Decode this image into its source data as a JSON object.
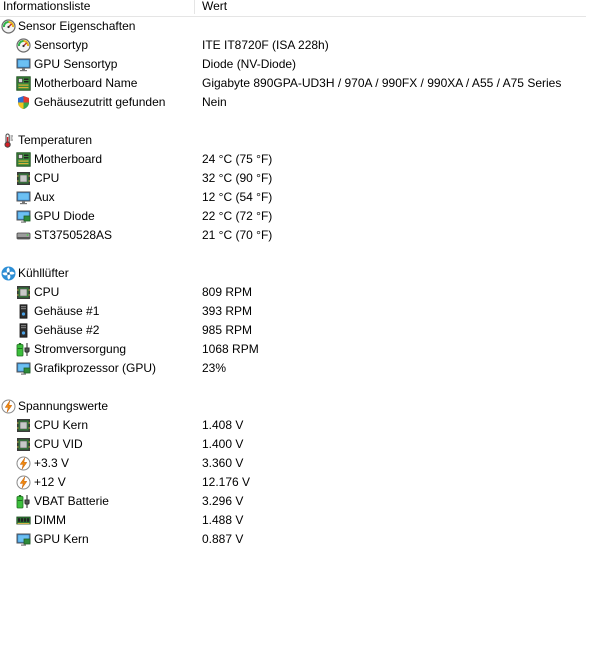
{
  "header": {
    "col_name": "Informationsliste",
    "col_value": "Wert"
  },
  "groups": [
    {
      "title": "Sensor Eigenschaften",
      "icon": "sensor-gauge-icon",
      "items": [
        {
          "label": "Sensortyp",
          "value": "ITE IT8720F  (ISA 228h)",
          "icon": "sensor-gauge-icon"
        },
        {
          "label": "GPU Sensortyp",
          "value": "Diode  (NV-Diode)",
          "icon": "monitor-icon"
        },
        {
          "label": "Motherboard Name",
          "value": "Gigabyte 890GPA-UD3H / 970A / 990FX / 990XA / A55 / A75 Series",
          "icon": "motherboard-icon"
        },
        {
          "label": "Gehäusezutritt gefunden",
          "value": "Nein",
          "icon": "shield-icon"
        }
      ]
    },
    {
      "title": "Temperaturen",
      "icon": "thermometer-icon",
      "items": [
        {
          "label": "Motherboard",
          "value": "24 °C  (75 °F)",
          "icon": "motherboard-icon"
        },
        {
          "label": "CPU",
          "value": "32 °C  (90 °F)",
          "icon": "cpu-chip-icon"
        },
        {
          "label": "Aux",
          "value": "12 °C  (54 °F)",
          "icon": "monitor-icon"
        },
        {
          "label": "GPU Diode",
          "value": "22 °C  (72 °F)",
          "icon": "gpu-monitor-icon"
        },
        {
          "label": "ST3750528AS",
          "value": "21 °C  (70 °F)",
          "icon": "hard-drive-icon"
        }
      ]
    },
    {
      "title": "Kühllüfter",
      "icon": "fan-icon",
      "items": [
        {
          "label": "CPU",
          "value": "809 RPM",
          "icon": "cpu-chip-icon"
        },
        {
          "label": "Gehäuse #1",
          "value": "393 RPM",
          "icon": "pc-case-icon"
        },
        {
          "label": "Gehäuse #2",
          "value": "985 RPM",
          "icon": "pc-case-icon"
        },
        {
          "label": "Stromversorgung",
          "value": "1068 RPM",
          "icon": "battery-plug-icon"
        },
        {
          "label": "Grafikprozessor (GPU)",
          "value": "23%",
          "icon": "gpu-monitor-icon"
        }
      ]
    },
    {
      "title": "Spannungswerte",
      "icon": "voltage-bolt-icon",
      "items": [
        {
          "label": "CPU Kern",
          "value": "1.408 V",
          "icon": "cpu-chip-icon"
        },
        {
          "label": "CPU VID",
          "value": "1.400 V",
          "icon": "cpu-chip-icon"
        },
        {
          "label": "+3.3 V",
          "value": "3.360 V",
          "icon": "voltage-bolt-icon"
        },
        {
          "label": "+12 V",
          "value": "12.176 V",
          "icon": "voltage-bolt-icon"
        },
        {
          "label": "VBAT Batterie",
          "value": "3.296 V",
          "icon": "battery-plug-icon"
        },
        {
          "label": "DIMM",
          "value": "1.488 V",
          "icon": "ram-module-icon"
        },
        {
          "label": "GPU Kern",
          "value": "0.887 V",
          "icon": "gpu-monitor-icon"
        }
      ]
    }
  ]
}
